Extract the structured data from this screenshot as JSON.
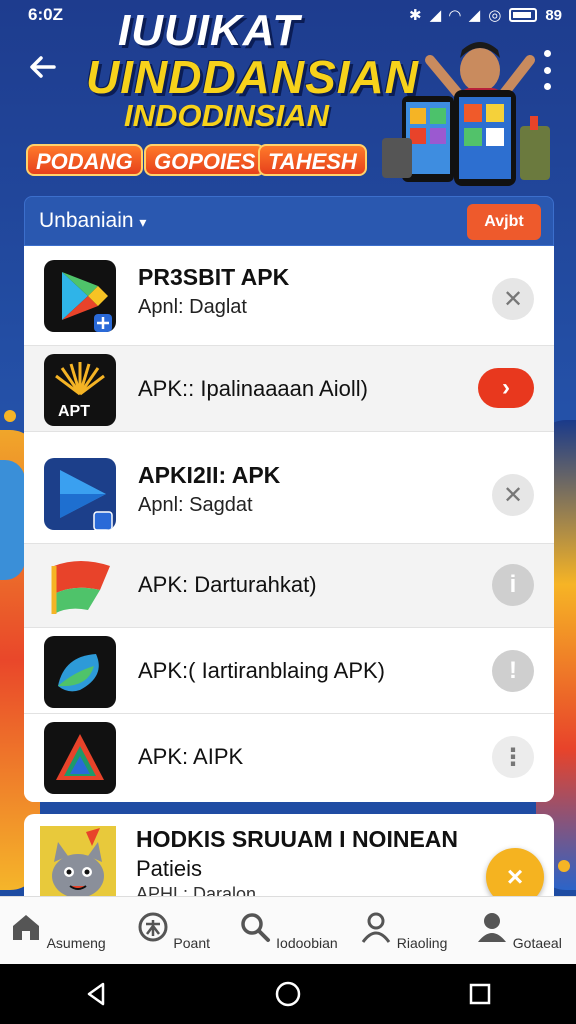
{
  "status_bar": {
    "time": "6:0Z",
    "battery": "89"
  },
  "header": {
    "title_line1": "IUUIKAT",
    "title_line2": "UINDDANSIAN",
    "title_line3": "INDODINSIAN",
    "pills": [
      "PODANG",
      "GOPOIES",
      "TAHESH"
    ]
  },
  "filter": {
    "dropdown_label": "Unbaniain",
    "button_label": "Avjbt"
  },
  "apps": [
    {
      "name": "PR3SBIT APK",
      "sub": "Apnl: Daglat",
      "action": "close-icon"
    },
    {
      "name": "APK:: Ipalinaaaan Aioll)",
      "action": "arrow-right-icon"
    },
    {
      "name": "APKI2II: APK",
      "sub": "Apnl: Sagdat",
      "action": "close-icon"
    },
    {
      "name": "APK: Darturahkat)",
      "action": "info-icon"
    },
    {
      "name": "APK:( Iartiranblaing APK)",
      "action": "info-icon"
    },
    {
      "name": "APK: AIPK",
      "action": "more-vertical-icon"
    }
  ],
  "promo": {
    "title": "HODKIS SRUUAM I NOINEAN",
    "line2": "Patieis",
    "line3": "APHL: Daralon"
  },
  "bottom_nav": [
    {
      "label": "Asumeng",
      "icon": "home-icon"
    },
    {
      "label": "Poant",
      "icon": "compass-icon"
    },
    {
      "label": "Iodoobian",
      "icon": "search-icon"
    },
    {
      "label": "Riaoling",
      "icon": "person-icon"
    },
    {
      "label": "Gotaeal",
      "icon": "account-icon"
    }
  ],
  "colors": {
    "accent": "#e8381e",
    "header_bg": "#1e3c8e",
    "yellow": "#f7d21b"
  }
}
